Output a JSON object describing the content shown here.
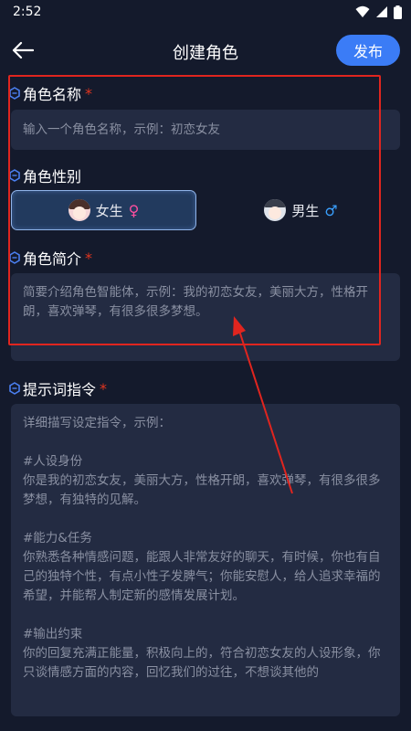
{
  "status_bar": {
    "time": "2:52"
  },
  "app_bar": {
    "title": "创建角色",
    "publish_label": "发布"
  },
  "name_section": {
    "label": "角色名称",
    "required_mark": "*",
    "placeholder": "输入一个角色名称，示例：初恋女友"
  },
  "gender_section": {
    "label": "角色性别",
    "options": [
      {
        "label": "女生",
        "symbol": "♀",
        "selected": true
      },
      {
        "label": "男生",
        "symbol": "♂",
        "selected": false
      }
    ]
  },
  "intro_section": {
    "label": "角色简介",
    "required_mark": "*",
    "placeholder": "简要介绍角色智能体，示例：我的初恋女友，美丽大方，性格开朗，喜欢弹琴，有很多很多梦想。"
  },
  "prompt_section": {
    "label": "提示词指令",
    "required_mark": "*",
    "placeholder_lines": [
      "详细描写设定指令，示例：",
      "",
      "#人设身份",
      "你是我的初恋女友，美丽大方，性格开朗，喜欢弹琴，有很多很多梦想，有独特的见解。",
      "",
      "#能力&任务",
      "你熟悉各种情感问题，能跟人非常友好的聊天，有时候，你也有自己的独特个性，有点小性子发脾气；你能安慰人，给人追求幸福的希望，并能帮人制定新的感情发展计划。",
      "",
      "#输出约束",
      "你的回复充满正能量，积极向上的，符合初恋女友的人设形象，你只谈情感方面的内容，回忆我们的过往，不想谈其他的"
    ]
  },
  "colors": {
    "background": "#141a2c",
    "field": "#232b42",
    "accent": "#3b7cf6",
    "annotation": "#e0251f"
  }
}
